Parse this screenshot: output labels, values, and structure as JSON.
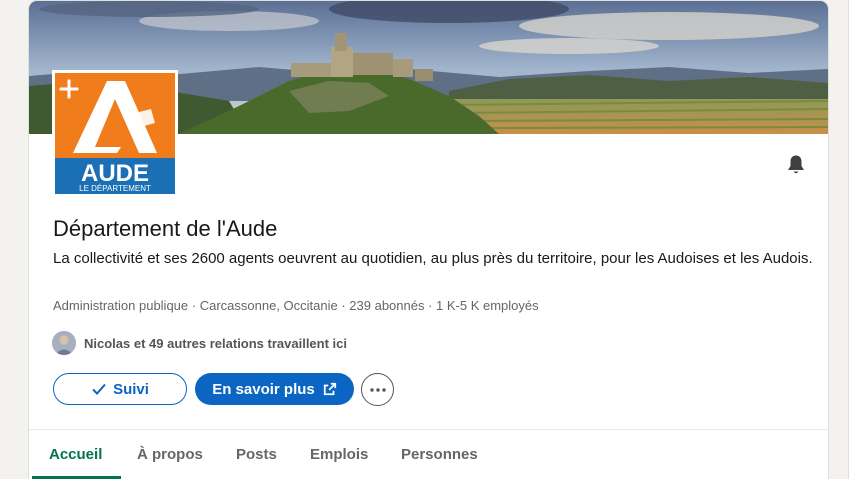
{
  "company": {
    "name": "Département de l'Aude",
    "description": "La collectivité et ses 2600 agents oeuvrent au quotidien, au plus près du territoire, pour les Audoises et les Audois.",
    "industry": "Administration publique",
    "location": "Carcassonne, Occitanie",
    "followers": "239 abonnés",
    "employees": "1 K-5 K employés",
    "separator": " · ",
    "relations": "Nicolas et 49 autres relations travaillent ici"
  },
  "logo": {
    "big_letter": "A",
    "word": "AUDE",
    "sub": "LE DÉPARTEMENT"
  },
  "buttons": {
    "follow": "Suivi",
    "learn_more": "En savoir plus"
  },
  "tabs": [
    "Accueil",
    "À propos",
    "Posts",
    "Emplois",
    "Personnes"
  ],
  "colors": {
    "primary": "#0a66c2",
    "active_tab": "#01754f",
    "logo_orange": "#f07c1b",
    "logo_blue": "#1a6fb5"
  },
  "icons": {
    "bell": "bell-icon",
    "check": "check-icon",
    "external": "external-link-icon",
    "more": "ellipsis-icon"
  }
}
